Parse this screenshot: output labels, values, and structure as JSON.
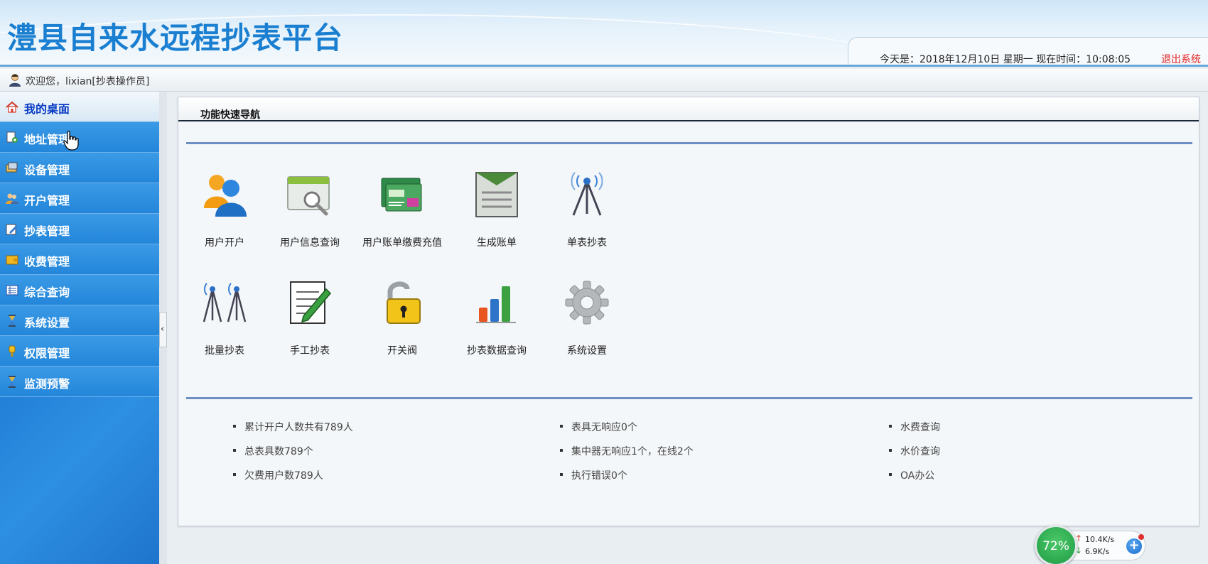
{
  "header": {
    "title": "澧县自来水远程抄表平台",
    "date_line": "今天是：2018年12月10日 星期一 现在时间：10:08:05",
    "logout_label": "退出系统"
  },
  "welcome": {
    "text": "欢迎您，lixian[抄表操作员]"
  },
  "sidebar": {
    "items": [
      {
        "label": "我的桌面",
        "icon": "home-icon"
      },
      {
        "label": "地址管理",
        "icon": "document-add-icon"
      },
      {
        "label": "设备管理",
        "icon": "device-icon"
      },
      {
        "label": "开户管理",
        "icon": "users-icon"
      },
      {
        "label": "抄表管理",
        "icon": "edit-icon"
      },
      {
        "label": "收费管理",
        "icon": "wallet-icon"
      },
      {
        "label": "综合查询",
        "icon": "list-icon"
      },
      {
        "label": "系统设置",
        "icon": "hourglass-icon"
      },
      {
        "label": "权限管理",
        "icon": "key-icon"
      },
      {
        "label": "监测预警",
        "icon": "hourglass-icon"
      }
    ],
    "collapse_glyph": "‹"
  },
  "panel": {
    "title": "功能快速导航",
    "tiles": [
      {
        "label": "用户开户",
        "icon": "user-add-icon"
      },
      {
        "label": "用户信息查询",
        "icon": "search-window-icon"
      },
      {
        "label": "用户账单缴费充值",
        "icon": "card-payment-icon"
      },
      {
        "label": "生成账单",
        "icon": "bill-icon"
      },
      {
        "label": "单表抄表",
        "icon": "antenna-icon"
      },
      {
        "label": "批量抄表",
        "icon": "multi-antenna-icon"
      },
      {
        "label": "手工抄表",
        "icon": "notepad-pencil-icon"
      },
      {
        "label": "开关阀",
        "icon": "padlock-icon"
      },
      {
        "label": "抄表数据查询",
        "icon": "bar-chart-icon"
      },
      {
        "label": "系统设置",
        "icon": "gear-icon"
      }
    ],
    "stats_col1": [
      "累计开户人数共有789人",
      "总表具数789个",
      "欠费用户数789人"
    ],
    "stats_col2": [
      "表具无响应0个",
      "集中器无响应1个，在线2个",
      "执行错误0个"
    ],
    "links_col3": [
      "水费查询",
      "水价查询",
      "OA办公"
    ]
  },
  "net_widget": {
    "percent": "72%",
    "upload": "10.4K/s",
    "download": "6.9K/s",
    "up_glyph": "↑",
    "down_glyph": "↓",
    "plus_glyph": "+"
  }
}
